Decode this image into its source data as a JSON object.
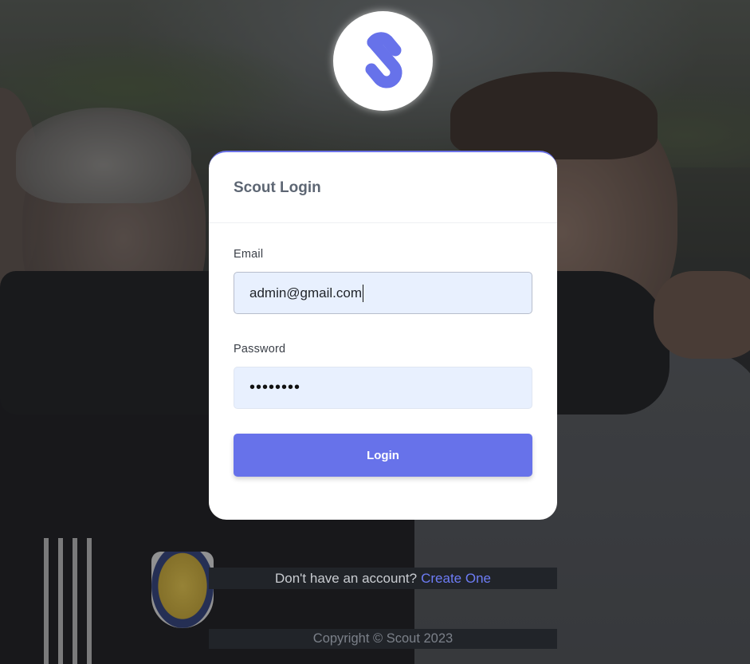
{
  "brand": {
    "logo_icon": "s-logo-icon",
    "accent_color": "#6772ea"
  },
  "card": {
    "title": "Scout Login",
    "email_label": "Email",
    "email_value": "admin@gmail.com",
    "password_label": "Password",
    "password_masked": "••••••••",
    "login_label": "Login"
  },
  "footer": {
    "signup_prompt": "Don't have an account?",
    "signup_link": "Create One",
    "copyright": "Copyright © Scout 2023"
  }
}
